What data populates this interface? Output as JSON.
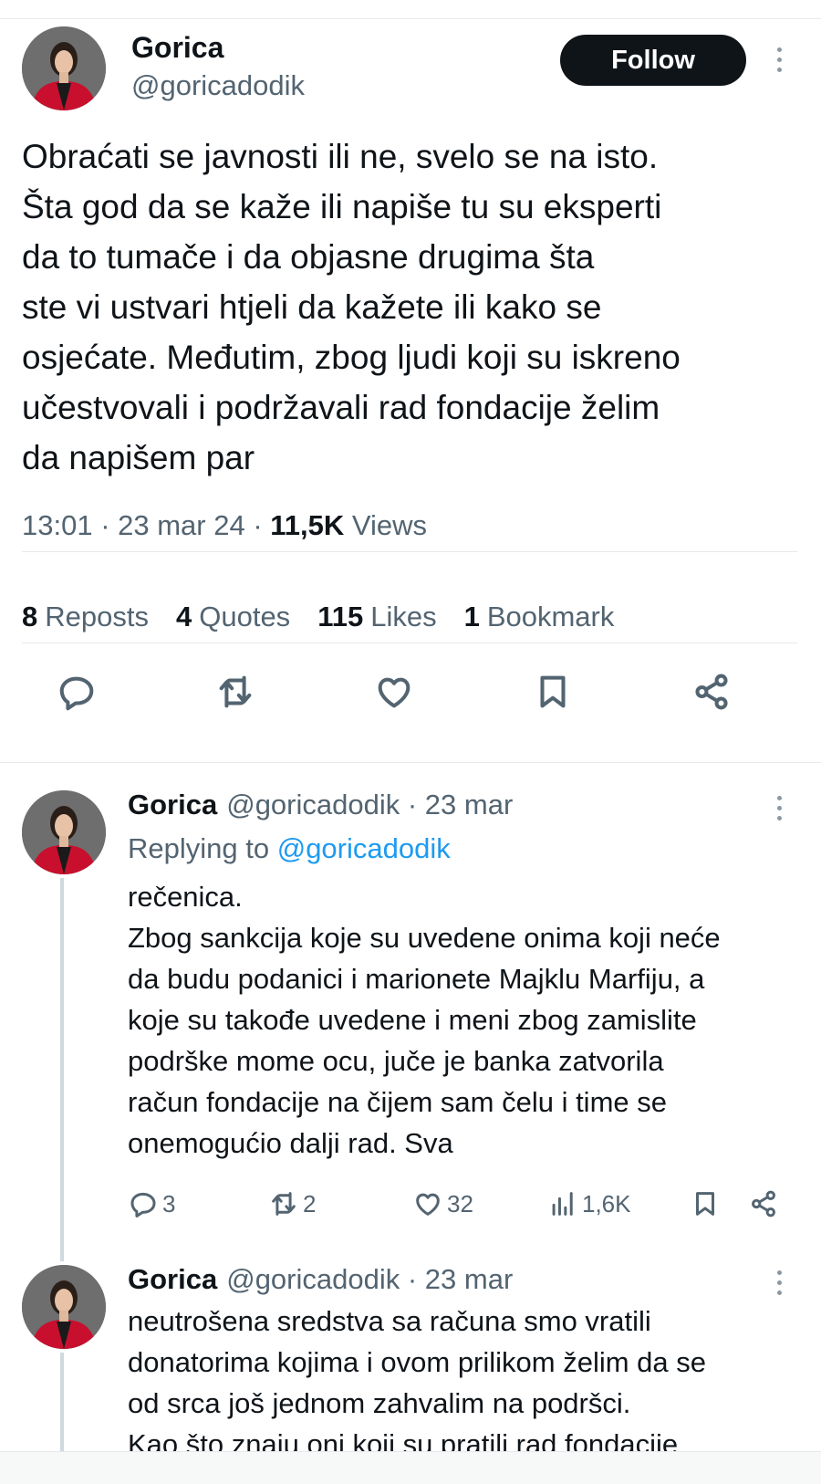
{
  "main_tweet": {
    "name": "Gorica",
    "handle": "@goricadodik",
    "follow_label": "Follow",
    "text": "Obraćati se javnosti ili ne, svelo se na isto.\nŠta god da se kaže ili napiše tu su eksperti\nda to tumače i da objasne drugima šta\nste vi ustvari htjeli da kažete ili kako se\nosjećate. Međutim, zbog ljudi koji su iskreno\nučestvovali i podržavali rad fondacije želim\nda napišem par",
    "time": "13:01",
    "date": "23 mar 24",
    "views_count": "11,5K",
    "views_label": "Views",
    "stats": {
      "reposts_count": "8",
      "reposts_label": "Reposts",
      "quotes_count": "4",
      "quotes_label": "Quotes",
      "likes_count": "115",
      "likes_label": "Likes",
      "bookmarks_count": "1",
      "bookmarks_label": "Bookmark"
    },
    "action_icons": [
      "reply-icon",
      "repost-icon",
      "like-icon",
      "bookmark-icon",
      "share-icon"
    ]
  },
  "replies": [
    {
      "name": "Gorica",
      "handle": "@goricadodik",
      "date": "23 mar",
      "replying_prefix": "Replying to",
      "replying_handle": "@goricadodik",
      "text": "rečenica.\nZbog sankcija koje su uvedene onima koji neće\nda budu podanici i marionete Majklu Marfiju, a\nkoje su takođe uvedene i meni zbog zamislite\npodrške mome ocu, juče je banka zatvorila\nračun fondacije na čijem sam čelu i time se\nonemogućio dalji rad. Sva",
      "replies_count": "3",
      "reposts_count": "2",
      "likes_count": "32",
      "views_count": "1,6K"
    },
    {
      "name": "Gorica",
      "handle": "@goricadodik",
      "date": "23 mar",
      "text": "neutrošena sredstva sa računa smo vratili\ndonatorima kojima i ovom prilikom želim da se\nod srca još jednom zahvalim na podršci.\nKao što znaju oni koji su pratili rad fondacije"
    }
  ],
  "colors": {
    "primary_text": "#0f1419",
    "secondary_text": "#536471",
    "link": "#1d9bf0",
    "follow_bg": "#0f1419",
    "divider": "#e6e9ec",
    "thread_line": "#cfd9de"
  }
}
